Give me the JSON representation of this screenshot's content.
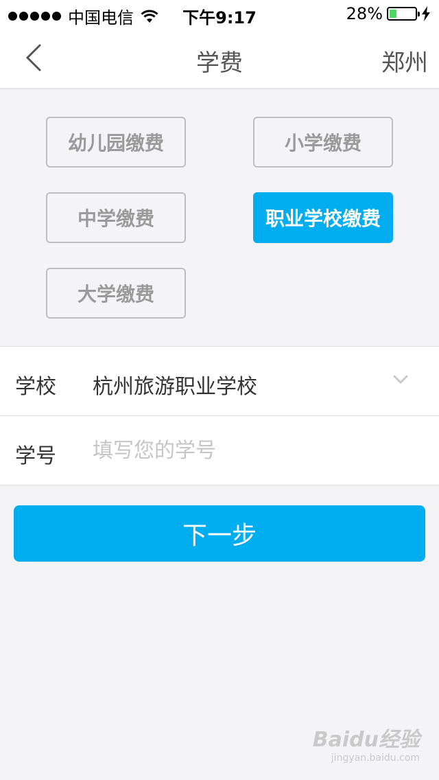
{
  "status_bar": {
    "carrier": "中国电信",
    "time": "下午9:17",
    "battery_percent": "28%",
    "battery_level": 0.28,
    "battery_color": "#4cd964"
  },
  "nav": {
    "back_icon": "chevron-left-icon",
    "title": "学费",
    "city": "郑州"
  },
  "categories": [
    {
      "label": "幼儿园缴费",
      "active": false
    },
    {
      "label": "小学缴费",
      "active": false
    },
    {
      "label": "中学缴费",
      "active": false
    },
    {
      "label": "职业学校缴费",
      "active": true
    },
    {
      "label": "大学缴费",
      "active": false
    }
  ],
  "form": {
    "school_label": "学校",
    "school_value": "杭州旅游职业学校",
    "student_id_label": "学号",
    "student_id_placeholder": "填写您的学号",
    "student_id_value": ""
  },
  "next_button": "下一步",
  "watermark": {
    "main": "Baidu经验",
    "sub": "jingyan.baidu.com"
  },
  "colors": {
    "accent": "#00aeef",
    "background": "#f4f4f6"
  }
}
